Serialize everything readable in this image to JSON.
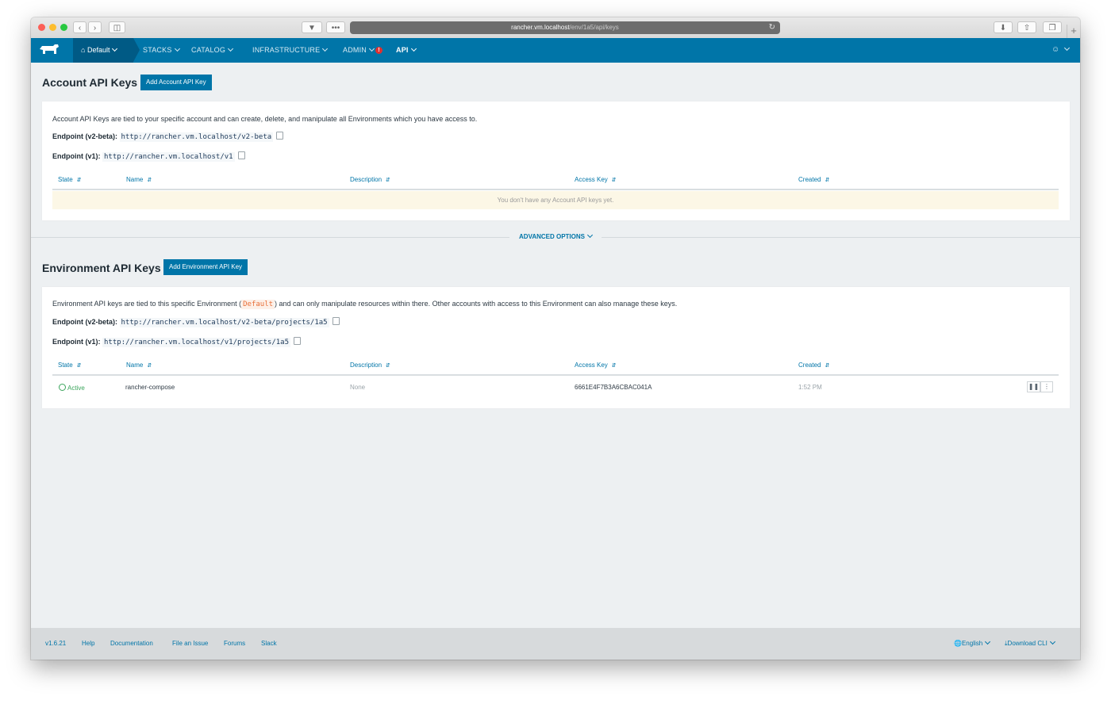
{
  "browser": {
    "url_host": "rancher.vm.localhost",
    "url_path": "/env/1a5/api/keys"
  },
  "nav": {
    "environment": "Default",
    "items": [
      "STACKS",
      "CATALOG",
      "INFRASTRUCTURE",
      "ADMIN",
      "API"
    ],
    "admin_alert": "!"
  },
  "account": {
    "title": "Account API Keys",
    "add_button": "Add Account API Key",
    "description": "Account API Keys are tied to your specific account and can create, delete, and manipulate all Environments which you have access to.",
    "endpoint_v2_label": "Endpoint (v2-beta):",
    "endpoint_v2": "http://rancher.vm.localhost/v2-beta",
    "endpoint_v1_label": "Endpoint (v1):",
    "endpoint_v1": "http://rancher.vm.localhost/v1",
    "columns": [
      "State",
      "Name",
      "Description",
      "Access Key",
      "Created"
    ],
    "empty_message": "You don't have any Account API keys yet."
  },
  "advanced_options": "ADVANCED OPTIONS",
  "environment": {
    "title": "Environment API Keys",
    "add_button": "Add Environment API Key",
    "description_pre": "Environment API keys are tied to this specific Environment (",
    "env_name": "Default",
    "description_post": ") and can only manipulate resources within there. Other accounts with access to this Environment can also manage these keys.",
    "endpoint_v2_label": "Endpoint (v2-beta):",
    "endpoint_v2": "http://rancher.vm.localhost/v2-beta/projects/1a5",
    "endpoint_v1_label": "Endpoint (v1):",
    "endpoint_v1": "http://rancher.vm.localhost/v1/projects/1a5",
    "columns": [
      "State",
      "Name",
      "Description",
      "Access Key",
      "Created"
    ],
    "rows": [
      {
        "state": "Active",
        "name": "rancher-compose",
        "description": "None",
        "access_key": "6661E4F7B3A6CBAC041A",
        "created": "1:52 PM"
      }
    ]
  },
  "footer": {
    "version": "v1.6.21",
    "links": [
      "Help",
      "Documentation",
      "File an Issue",
      "Forums",
      "Slack"
    ],
    "language": "English",
    "download": "Download CLI"
  },
  "colors": {
    "brand": "#0075a8",
    "brand_dark": "#005a85",
    "active_state": "#3ba55c",
    "empty_row_bg": "#fcf7e6"
  }
}
